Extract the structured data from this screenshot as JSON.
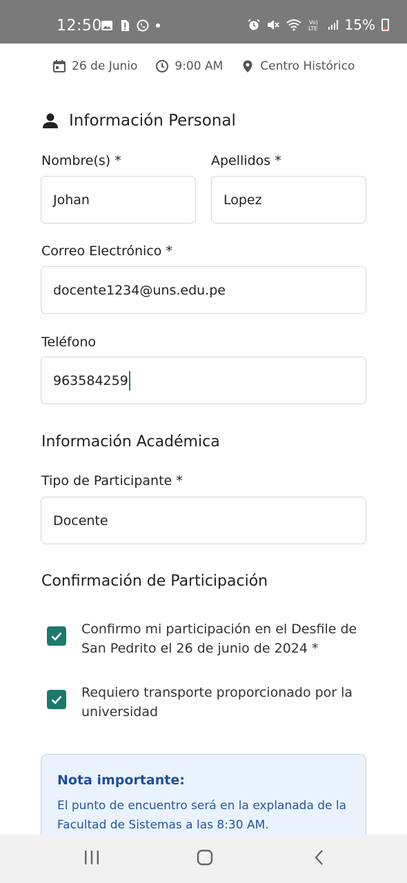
{
  "status_bar": {
    "time": "12:50",
    "battery": "15%"
  },
  "event_meta": {
    "date": "26 de Junio",
    "time": "9:00 AM",
    "location": "Centro Histórico"
  },
  "personal_info": {
    "section_title": "Información Personal",
    "first_name_label": "Nombre(s) *",
    "first_name_value": "Johan",
    "last_name_label": "Apellidos *",
    "last_name_value": "Lopez",
    "email_label": "Correo Electrónico *",
    "email_value": "docente1234@uns.edu.pe",
    "phone_label": "Teléfono",
    "phone_value": "963584259"
  },
  "academic_info": {
    "section_title": "Información Académica",
    "participant_type_label": "Tipo de Participante *",
    "participant_type_value": "Docente"
  },
  "confirmation": {
    "section_title": "Confirmación de Participación",
    "confirm_text": "Confirmo mi participación en el Desfile de San Pedrito el 26 de junio de 2024 *",
    "confirm_checked": true,
    "transport_text": "Requiero transporte proporcionado por la universidad",
    "transport_checked": true
  },
  "note": {
    "title": "Nota importante:",
    "text": "El punto de encuentro será en la explanada de la Facultad de Sistemas a las 8:30 AM."
  },
  "colors": {
    "accent": "#1b7a6b",
    "note_bg": "#eaf3fd",
    "note_text": "#2555a8"
  }
}
